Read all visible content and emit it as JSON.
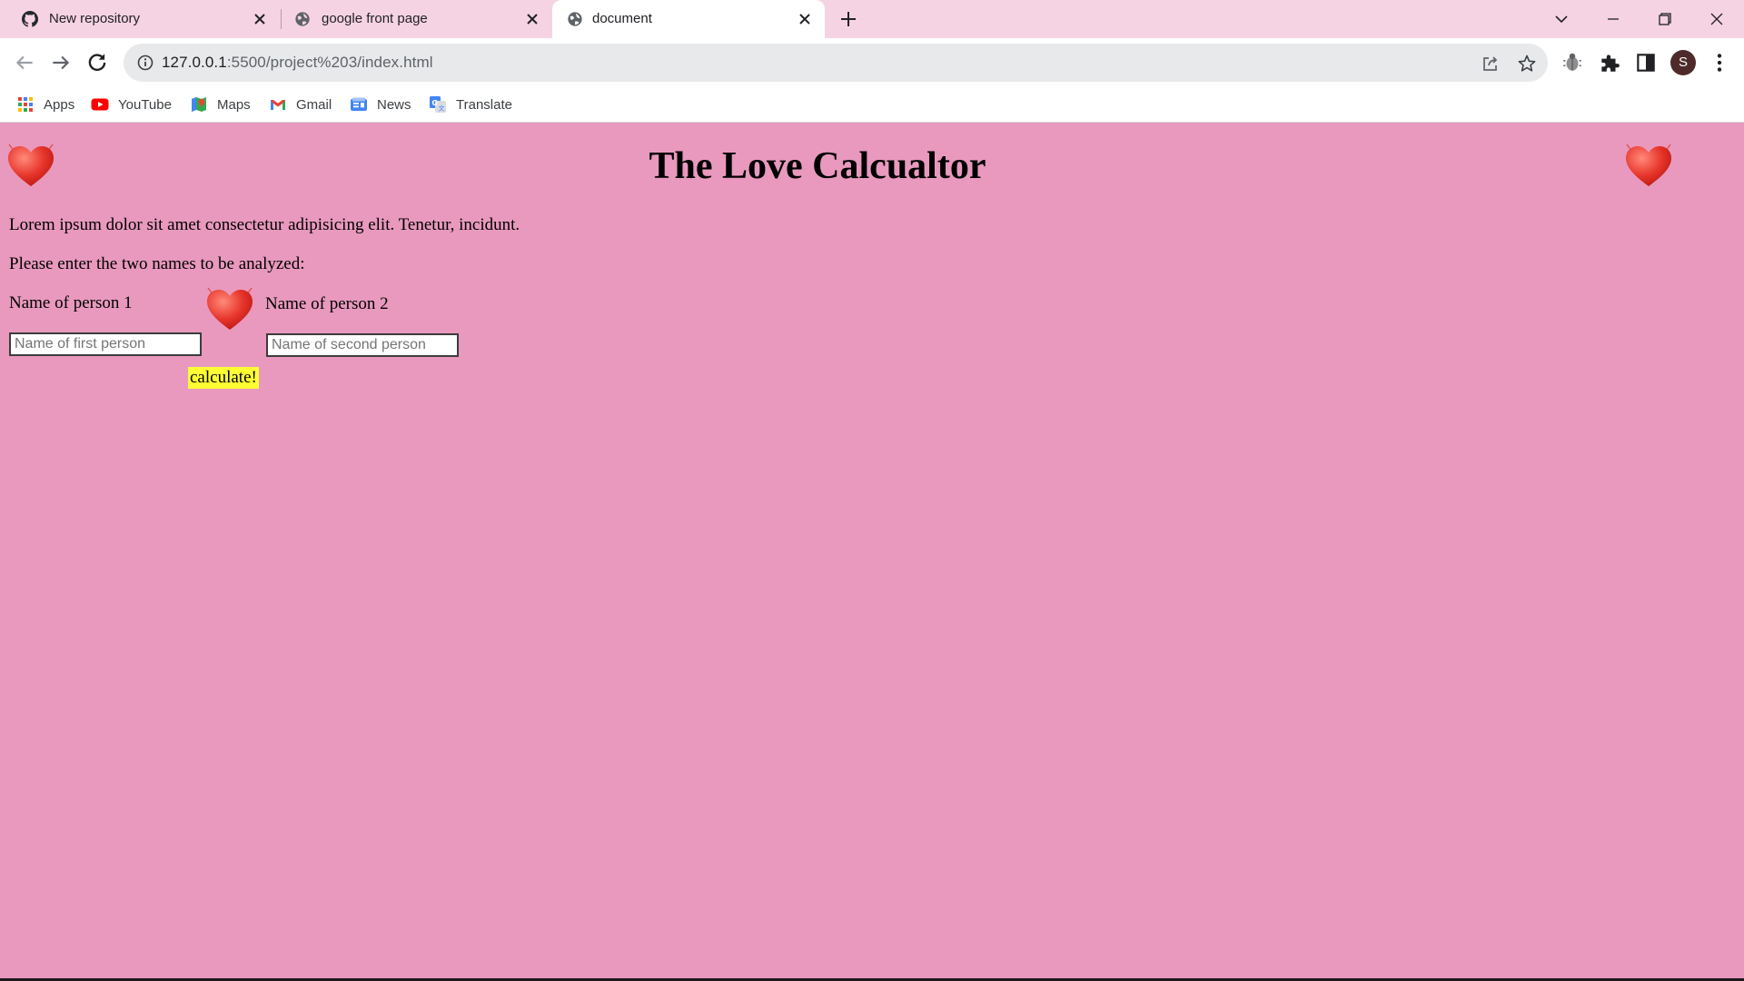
{
  "browser": {
    "tabs": [
      {
        "title": "New repository",
        "icon": "github-icon"
      },
      {
        "title": "google front page",
        "icon": "globe-icon"
      },
      {
        "title": "document",
        "icon": "globe-icon",
        "active": true
      }
    ],
    "url_host": "127.0.0.1",
    "url_rest": ":5500/project%203/index.html",
    "profile_initial": "S",
    "bookmarks": [
      "Apps",
      "YouTube",
      "Maps",
      "Gmail",
      "News",
      "Translate"
    ]
  },
  "page": {
    "title": "The Love Calcualtor",
    "intro": "Lorem ipsum dolor sit amet consectetur adipisicing elit. Tenetur, incidunt.",
    "prompt": "Please enter the two names to be analyzed:",
    "person1_label": "Name of person 1",
    "person2_label": "Name of person 2",
    "person1_placeholder": "Name of first person",
    "person2_placeholder": "Name of second person",
    "button_label": "calculate!"
  },
  "colors": {
    "page_background": "#e899bd",
    "tabstrip": "#f6d3e2",
    "button_background": "#ffff33",
    "heart": "#e8352b"
  }
}
